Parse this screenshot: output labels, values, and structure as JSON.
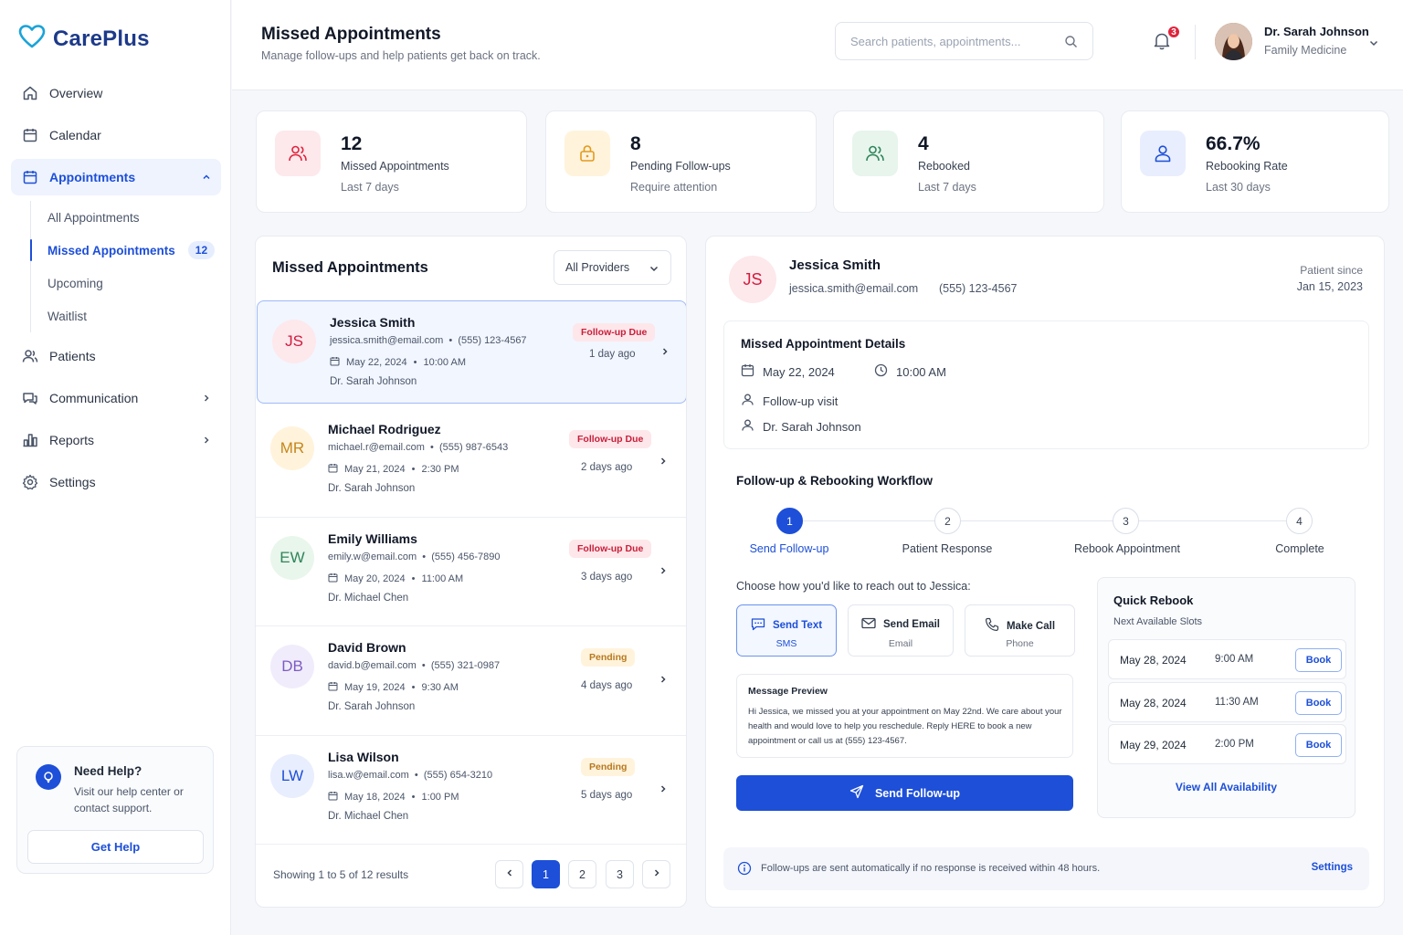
{
  "app": {
    "name": "CarePlus"
  },
  "colors": {
    "primary": "#1d4fd8",
    "danger": "#c81e3a",
    "warning": "#b7791f",
    "success": "#2f855a"
  },
  "sidebar": {
    "items": [
      {
        "label": "Overview",
        "icon": "home-icon"
      },
      {
        "label": "Calendar",
        "icon": "calendar-icon"
      },
      {
        "label": "Appointments",
        "icon": "calendar-check-icon"
      },
      {
        "label": "Patients",
        "icon": "users-icon"
      },
      {
        "label": "Communication",
        "icon": "chat-icon"
      },
      {
        "label": "Reports",
        "icon": "bar-chart-icon"
      },
      {
        "label": "Settings",
        "icon": "gear-icon"
      }
    ],
    "subitems": [
      {
        "label": "All Appointments"
      },
      {
        "label": "Missed Appointments",
        "count": "12"
      },
      {
        "label": "Upcoming"
      },
      {
        "label": "Waitlist"
      }
    ],
    "help": {
      "title": "Need Help?",
      "text": "Visit our help center or contact support.",
      "button": "Get Help"
    }
  },
  "header": {
    "title": "Missed Appointments",
    "subtitle": "Manage follow-ups and help patients get back on track.",
    "search_placeholder": "Search patients, appointments...",
    "notifications": "3",
    "user": {
      "name": "Dr. Sarah Johnson",
      "role": "Family Medicine"
    }
  },
  "stats": [
    {
      "value": "12",
      "label": "Missed Appointments",
      "sub": "Last 7 days",
      "icon": "users-icon"
    },
    {
      "value": "8",
      "label": "Pending Follow-ups",
      "sub": "Require attention",
      "icon": "lock-icon"
    },
    {
      "value": "4",
      "label": "Rebooked",
      "sub": "Last 7 days",
      "icon": "users-icon"
    },
    {
      "value": "66.7%",
      "label": "Rebooking Rate",
      "sub": "Last 30 days",
      "icon": "user-icon"
    }
  ],
  "list": {
    "title": "Missed Appointments",
    "provider_filter": "All Providers",
    "patients": [
      {
        "initials": "JS",
        "name": "Jessica Smith",
        "email": "jessica.smith@email.com",
        "phone": "(555) 123-4567",
        "date": "May 22, 2024",
        "time": "10:00 AM",
        "doctor": "Dr. Sarah Johnson",
        "status": "Follow-up Due",
        "ago": "1 day ago"
      },
      {
        "initials": "MR",
        "name": "Michael Rodriguez",
        "email": "michael.r@email.com",
        "phone": "(555) 987-6543",
        "date": "May 21, 2024",
        "time": "2:30 PM",
        "doctor": "Dr. Sarah Johnson",
        "status": "Follow-up Due",
        "ago": "2 days ago"
      },
      {
        "initials": "EW",
        "name": "Emily Williams",
        "email": "emily.w@email.com",
        "phone": "(555) 456-7890",
        "date": "May 20, 2024",
        "time": "11:00 AM",
        "doctor": "Dr. Michael Chen",
        "status": "Follow-up Due",
        "ago": "3 days ago"
      },
      {
        "initials": "DB",
        "name": "David Brown",
        "email": "david.b@email.com",
        "phone": "(555) 321-0987",
        "date": "May 19, 2024",
        "time": "9:30 AM",
        "doctor": "Dr. Sarah Johnson",
        "status": "Pending",
        "ago": "4 days ago"
      },
      {
        "initials": "LW",
        "name": "Lisa Wilson",
        "email": "lisa.w@email.com",
        "phone": "(555) 654-3210",
        "date": "May 18, 2024",
        "time": "1:00 PM",
        "doctor": "Dr. Michael Chen",
        "status": "Pending",
        "ago": "5 days ago"
      }
    ],
    "footer": "Showing 1 to 5 of 12 results",
    "pages": [
      "1",
      "2",
      "3"
    ]
  },
  "detail": {
    "initials": "JS",
    "name": "Jessica Smith",
    "email": "jessica.smith@email.com",
    "phone": "(555) 123-4567",
    "since_label": "Patient since",
    "since_value": "Jan 15, 2023",
    "missed": {
      "title": "Missed Appointment Details",
      "date": "May 22, 2024",
      "time": "10:00 AM",
      "type": "Follow-up visit",
      "doctor": "Dr. Sarah Johnson"
    },
    "workflow": {
      "title": "Follow-up & Rebooking Workflow",
      "steps": [
        {
          "num": "1",
          "label": "Send Follow-up"
        },
        {
          "num": "2",
          "label": "Patient Response"
        },
        {
          "num": "3",
          "label": "Rebook Appointment"
        },
        {
          "num": "4",
          "label": "Complete"
        }
      ],
      "choose": "Choose how you'd like to reach out to Jessica:",
      "options": [
        {
          "label": "Send Text",
          "sub": "SMS",
          "icon": "message-icon"
        },
        {
          "label": "Send Email",
          "sub": "Email",
          "icon": "mail-icon"
        },
        {
          "label": "Make Call",
          "sub": "Phone",
          "icon": "phone-icon"
        }
      ],
      "preview_title": "Message Preview",
      "preview_body": "Hi Jessica, we missed you at your appointment on May 22nd. We care about your health and would love to help you reschedule. Reply HERE to book a new appointment or call us at (555) 123-4567.",
      "send_label": "Send Follow-up"
    },
    "quick_rebook": {
      "title": "Quick Rebook",
      "sub": "Next Available Slots",
      "slots": [
        {
          "date": "May 28, 2024",
          "time": "9:00 AM",
          "action": "Book"
        },
        {
          "date": "May 28, 2024",
          "time": "11:30 AM",
          "action": "Book"
        },
        {
          "date": "May 29, 2024",
          "time": "2:00 PM",
          "action": "Book"
        }
      ],
      "link": "View All Availability"
    },
    "info": {
      "text": "Follow-ups are sent automatically if no response is received within 48 hours.",
      "link": "Settings"
    }
  }
}
